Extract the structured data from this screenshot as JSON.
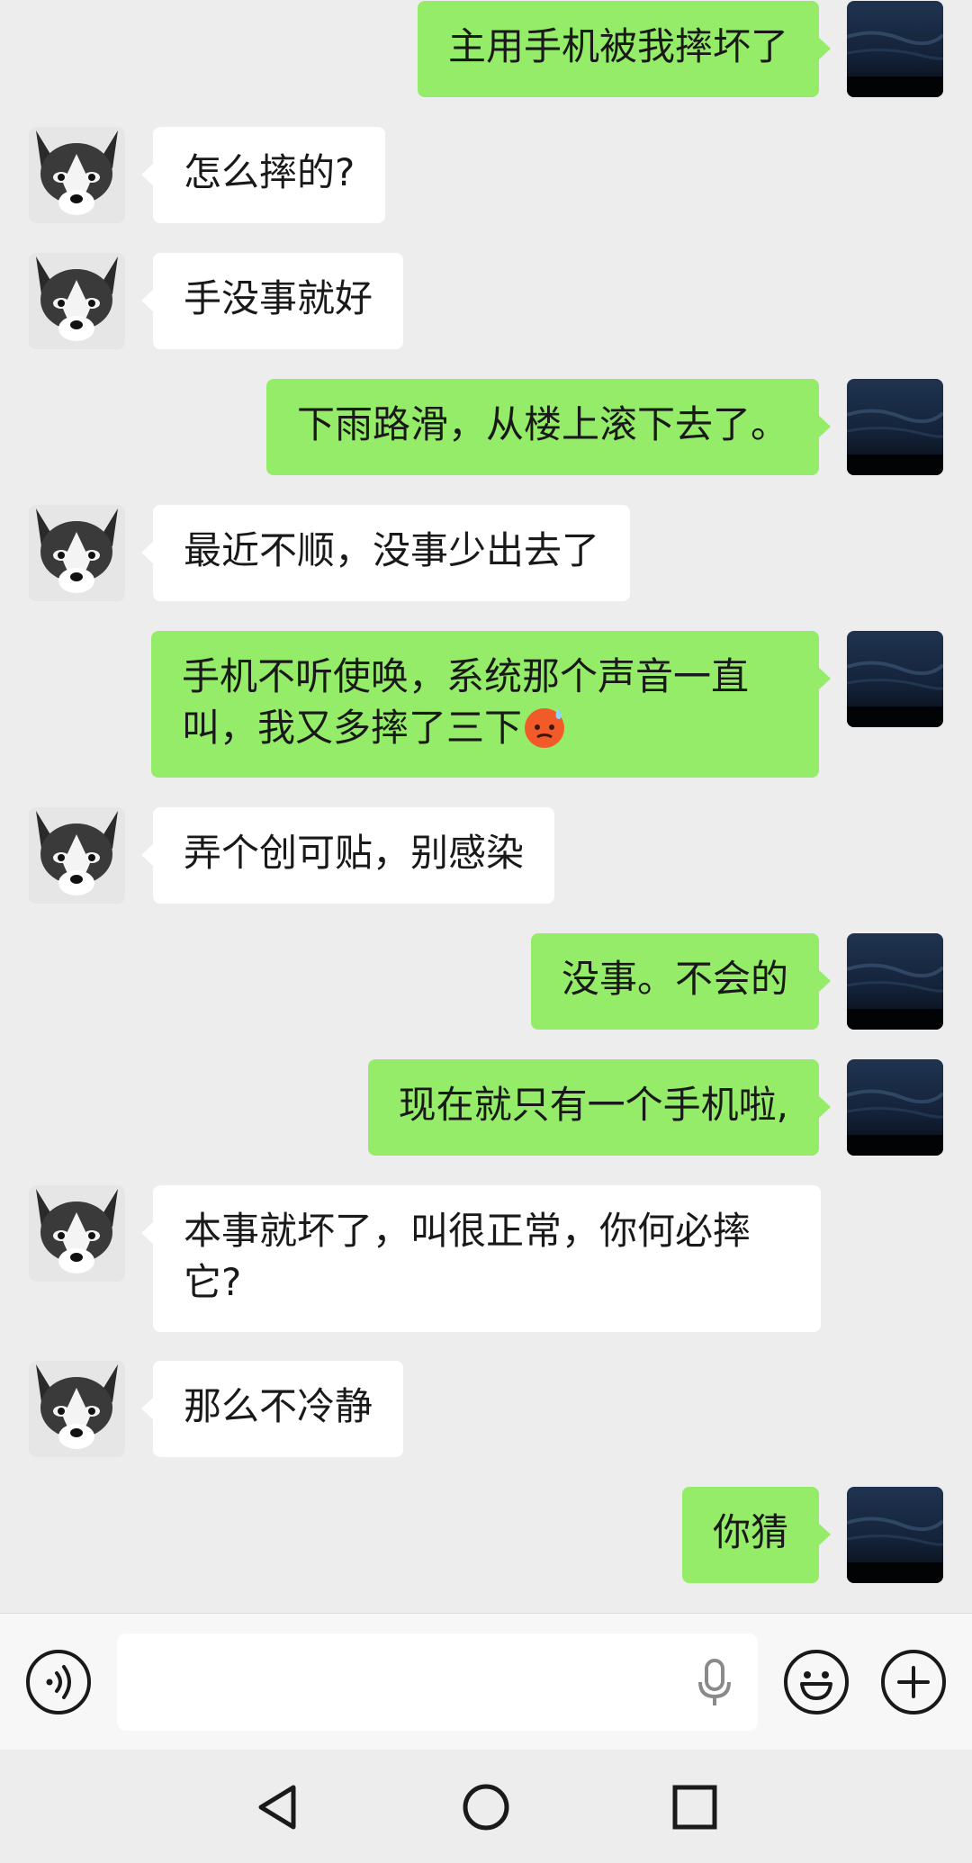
{
  "messages": [
    {
      "side": "out",
      "text": "主用手机被我摔坏了"
    },
    {
      "side": "in",
      "text": "怎么摔的?"
    },
    {
      "side": "in",
      "text": "手没事就好"
    },
    {
      "side": "out",
      "text": "下雨路滑，从楼上滚下去了。"
    },
    {
      "side": "in",
      "text": "最近不顺，没事少出去了"
    },
    {
      "side": "out",
      "text": "手机不听使唤，系统那个声音一直叫，我又多摔了三下",
      "emoji": "cold-sweat-face-emoji"
    },
    {
      "side": "in",
      "text": "弄个创可贴，别感染"
    },
    {
      "side": "out",
      "text": "没事。不会的"
    },
    {
      "side": "out",
      "text": "现在就只有一个手机啦,"
    },
    {
      "side": "in",
      "text": "本事就坏了，叫很正常，你何必摔它?"
    },
    {
      "side": "in",
      "text": "那么不冷静"
    },
    {
      "side": "out",
      "text": "你猜"
    }
  ],
  "input_bar": {
    "voice_icon": "voice-icon",
    "input_value": "",
    "mic_icon": "microphone-icon",
    "emoji_icon": "emoji-icon",
    "plus_icon": "plus-icon"
  },
  "nav_bar": {
    "back_icon": "back-triangle-icon",
    "home_icon": "home-circle-icon",
    "recents_icon": "recents-square-icon"
  },
  "colors": {
    "background": "#ededed",
    "outgoing_bubble": "#95ec69",
    "incoming_bubble": "#ffffff",
    "text": "#191919"
  }
}
